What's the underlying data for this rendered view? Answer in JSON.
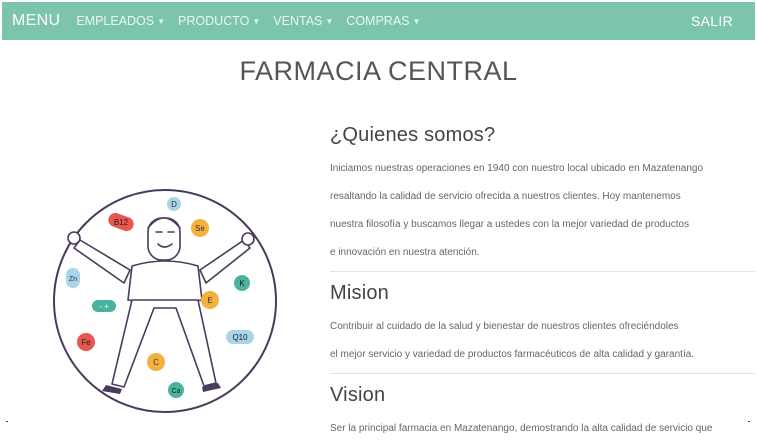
{
  "navbar": {
    "brand": "MENU",
    "items": [
      {
        "label": "EMPLEADOS"
      },
      {
        "label": "PRODUCTO"
      },
      {
        "label": "VENTAS"
      },
      {
        "label": "COMPRAS"
      }
    ],
    "logout": "SALIR"
  },
  "page": {
    "title": "FARMACIA CENTRAL"
  },
  "sections": {
    "about": {
      "heading": "¿Quienes somos?",
      "lines": [
        "Iniciamos nuestras operaciones en 1940 con nuestro local ubicado en Mazatenango",
        "resaltando la calidad de servicio ofrecida a nuestros clientes. Hoy mantenemos",
        "nuestra filosofía y buscamos llegar a ustedes con la mejor variedad de productos",
        "e innovación en nuestra atención."
      ]
    },
    "mission": {
      "heading": "Mision",
      "lines": [
        "Contribuir al cuidado de la salud y bienestar de nuestros clientes ofreciéndoles",
        "el mejor servicio y variedad de productos farmacéuticos de alta calidad y garantía."
      ]
    },
    "vision": {
      "heading": "Vision",
      "lines": [
        "Ser la principal farmacia en Mazatenango, demostrando la alta calidad de servicio que"
      ]
    }
  },
  "illustration": {
    "pills": [
      {
        "label": "D",
        "color": "#a9d4ea"
      },
      {
        "label": "B12",
        "color": "#e8574f"
      },
      {
        "label": "Se",
        "color": "#f4b13f"
      },
      {
        "label": "Zn",
        "color": "#a9d4ea"
      },
      {
        "label": "K",
        "color": "#49b3a0"
      },
      {
        "label": "E",
        "color": "#f4b13f"
      },
      {
        "label": "Fe",
        "color": "#e8574f"
      },
      {
        "label": "Q10",
        "color": "#a9d4ea"
      },
      {
        "label": "C",
        "color": "#f4b13f"
      },
      {
        "label": "Ca",
        "color": "#49b3a0"
      }
    ]
  }
}
